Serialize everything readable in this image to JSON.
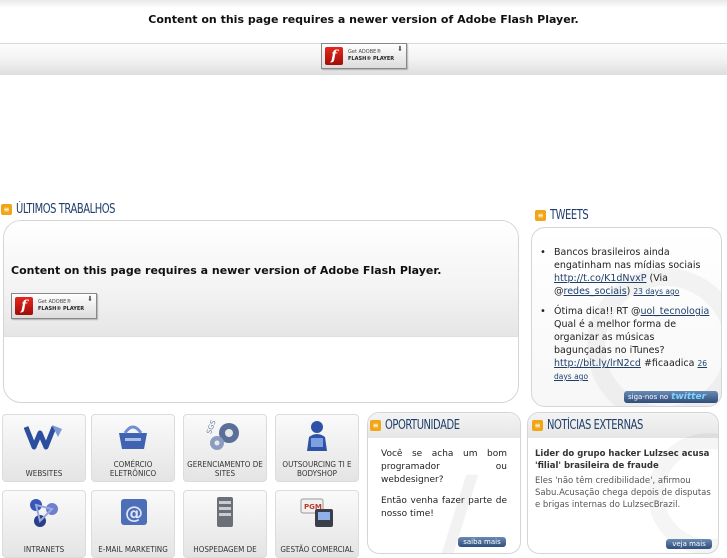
{
  "flash_notice": {
    "message": "Content on this page requires a newer version of Adobe Flash Player.",
    "badge_top": "Get ADOBE®",
    "badge_bottom": "FLASH® PLAYER"
  },
  "sections": {
    "ultimos_trabalhos": "ÚLTIMOS TRABALHOS",
    "tweets": "TWEETS",
    "oportunidade": "OPORTUNIDADE",
    "noticias": "NOTÍCIAS EXTERNAS"
  },
  "tweets": [
    {
      "text": "Bancos brasileiros ainda engatinham nas mídias sociais ",
      "link": "http://t.co/K1dNvxP",
      "extra_pre": " (Via @",
      "mention": "redes_sociais",
      "extra_post": ") ",
      "ago": "23 days ago"
    },
    {
      "text": "Ótima dica!! RT @",
      "mention": "uol_tecnologia",
      "text2": " Qual é a melhor forma de organizar as músicas bagunçadas no iTunes? ",
      "link": "http://bit.ly/lrN2cd",
      "extra_post": " #ficaadica ",
      "ago": "26 days ago"
    }
  ],
  "twitter_button": {
    "label": "siga-nos no",
    "brand": "twitter"
  },
  "services": [
    {
      "label": "WEBSITES",
      "icon": "websites-icon"
    },
    {
      "label": "COMÉRCIO ELETRÔNICO",
      "icon": "ecommerce-icon"
    },
    {
      "label": "GERENCIAMENTO DE SITES",
      "icon": "gears-icon"
    },
    {
      "label": "OUTSOURCING TI E BODYSHOP",
      "icon": "person-icon"
    },
    {
      "label": "INTRANETS",
      "icon": "network-icon"
    },
    {
      "label": "E-MAIL MARKETING",
      "icon": "email-icon"
    },
    {
      "label": "HOSPEDAGEM DE",
      "icon": "server-icon"
    },
    {
      "label": "GESTÃO COMERCIAL",
      "icon": "pgm-icon"
    }
  ],
  "oportunidade": {
    "p1": "Você se acha um bom programador ou webdesigner?",
    "p2": "Então venha fazer parte de nosso time!",
    "more": "saiba mais"
  },
  "noticias": {
    "title": "Lider do grupo hacker Lulzsec acusa 'filial' brasileira de fraude",
    "body": "Eles 'não têm credibilidade', afirmou Sabu.Acusação chega depois de disputas e brigas internas do LulzsecBrazil.",
    "more": "veja mais"
  },
  "colors": {
    "heading": "#1f3f6b",
    "accent": "#f2a516",
    "button": "#2f4e7a"
  }
}
